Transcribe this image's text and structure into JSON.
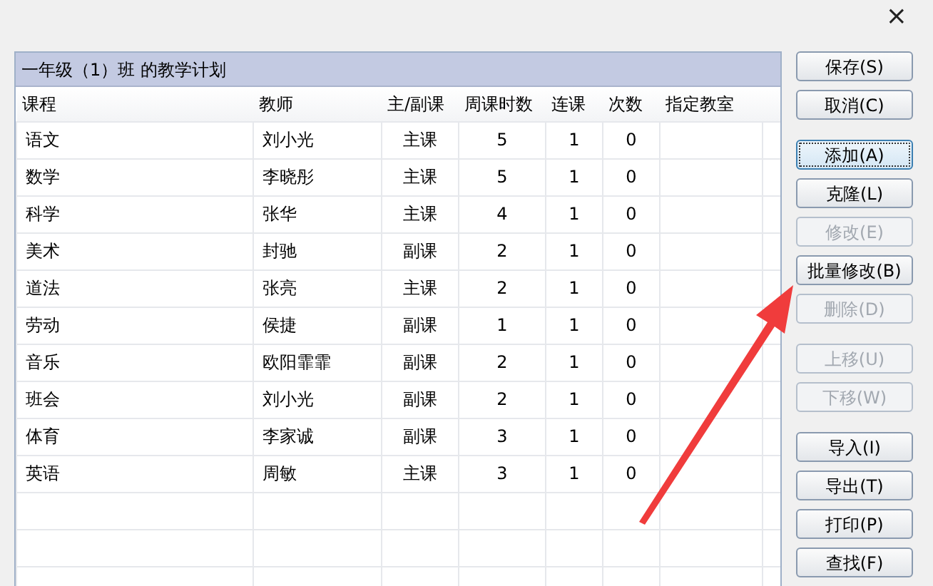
{
  "window": {
    "close": "×"
  },
  "plan": {
    "title": "一年级（1）班 的教学计划",
    "columns": [
      "课程",
      "教师",
      "主/副课",
      "周课时数",
      "连课",
      "次数",
      "指定教室"
    ],
    "rows": [
      [
        "语文",
        "刘小光",
        "主课",
        "5",
        "1",
        "0",
        ""
      ],
      [
        "数学",
        "李晓彤",
        "主课",
        "5",
        "1",
        "0",
        ""
      ],
      [
        "科学",
        "张华",
        "主课",
        "4",
        "1",
        "0",
        ""
      ],
      [
        "美术",
        "封驰",
        "副课",
        "2",
        "1",
        "0",
        ""
      ],
      [
        "道法",
        "张亮",
        "主课",
        "2",
        "1",
        "0",
        ""
      ],
      [
        "劳动",
        "侯捷",
        "副课",
        "1",
        "1",
        "0",
        ""
      ],
      [
        "音乐",
        "欧阳霏霏",
        "副课",
        "2",
        "1",
        "0",
        ""
      ],
      [
        "班会",
        "刘小光",
        "副课",
        "2",
        "1",
        "0",
        ""
      ],
      [
        "体育",
        "李家诚",
        "副课",
        "3",
        "1",
        "0",
        ""
      ],
      [
        "英语",
        "周敏",
        "主课",
        "3",
        "1",
        "0",
        ""
      ]
    ]
  },
  "button_groups": [
    [
      {
        "label": "保存(S)",
        "disabled": false,
        "focused": false
      },
      {
        "label": "取消(C)",
        "disabled": false,
        "focused": false
      }
    ],
    [
      {
        "label": "添加(A)",
        "disabled": false,
        "focused": true
      },
      {
        "label": "克隆(L)",
        "disabled": false,
        "focused": false
      },
      {
        "label": "修改(E)",
        "disabled": true,
        "focused": false
      },
      {
        "label": "批量修改(B)",
        "disabled": false,
        "focused": false
      },
      {
        "label": "删除(D)",
        "disabled": true,
        "focused": false
      }
    ],
    [
      {
        "label": "上移(U)",
        "disabled": true,
        "focused": false
      },
      {
        "label": "下移(W)",
        "disabled": true,
        "focused": false
      }
    ],
    [
      {
        "label": "导入(I)",
        "disabled": false,
        "focused": false
      },
      {
        "label": "导出(T)",
        "disabled": false,
        "focused": false
      },
      {
        "label": "打印(P)",
        "disabled": false,
        "focused": false
      },
      {
        "label": "查找(F)",
        "disabled": false,
        "focused": false
      }
    ]
  ]
}
